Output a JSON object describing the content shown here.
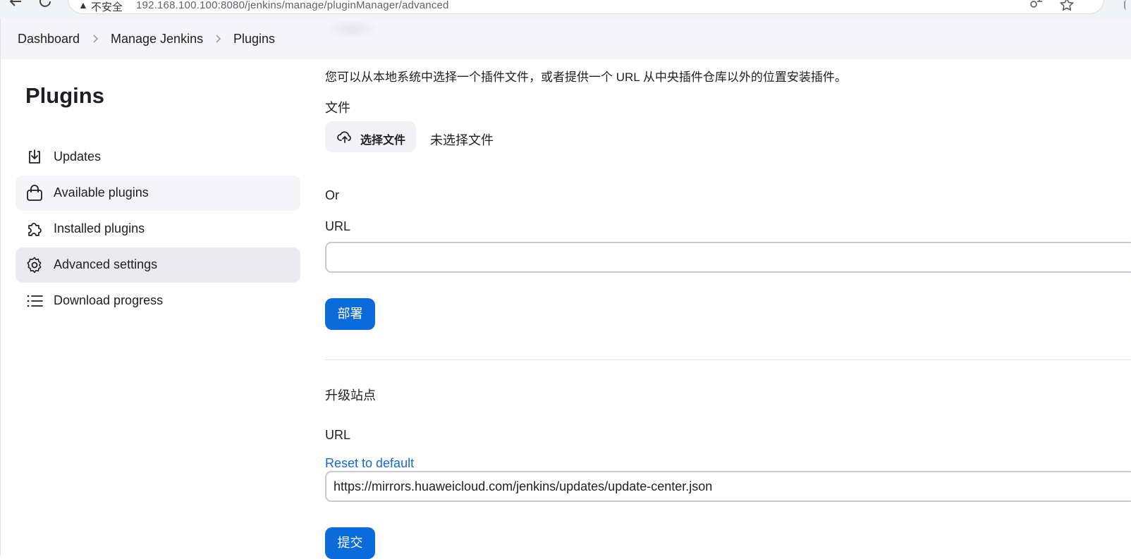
{
  "browser": {
    "insecure_label": "不安全",
    "url": "192.168.100.100:8080/jenkins/manage/pluginManager/advanced"
  },
  "breadcrumb": {
    "items": [
      {
        "label": "Dashboard"
      },
      {
        "label": "Manage Jenkins"
      },
      {
        "label": "Plugins"
      }
    ]
  },
  "sidebar": {
    "title": "Plugins",
    "items": [
      {
        "label": "Updates",
        "icon": "download-icon"
      },
      {
        "label": "Available plugins",
        "icon": "shopping-bag-icon"
      },
      {
        "label": "Installed plugins",
        "icon": "puzzle-icon"
      },
      {
        "label": "Advanced settings",
        "icon": "gear-icon",
        "active": true
      },
      {
        "label": "Download progress",
        "icon": "list-icon"
      }
    ]
  },
  "deploy": {
    "description": "您可以从本地系统中选择一个插件文件，或者提供一个 URL 从中央插件仓库以外的位置安装插件。",
    "file_label": "文件",
    "choose_file_button": "选择文件",
    "no_file_selected": "未选择文件",
    "or_label": "Or",
    "url_label": "URL",
    "url_value": "",
    "deploy_button": "部署"
  },
  "update_site": {
    "heading": "升级站点",
    "url_label": "URL",
    "reset_link": "Reset to default",
    "url_value": "https://mirrors.huaweicloud.com/jenkins/updates/update-center.json",
    "submit_button": "提交"
  },
  "colors": {
    "primary": "#0b6bdb",
    "link": "#1468d6",
    "active_item_bg": "#ebebef"
  }
}
